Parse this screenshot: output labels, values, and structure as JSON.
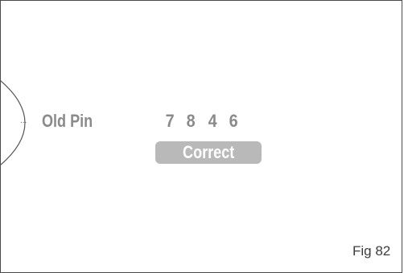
{
  "display": {
    "indicator": "...",
    "label": "Old Pin",
    "pin_digits": [
      "7",
      "8",
      "4",
      "6"
    ],
    "status": "Correct"
  },
  "figure": {
    "caption": "Fig 82"
  },
  "colors": {
    "text_gray": "#8a8a8a",
    "badge_gray": "#b9b9b9",
    "badge_text": "#ffffff",
    "frame": "#4a4a4a"
  }
}
